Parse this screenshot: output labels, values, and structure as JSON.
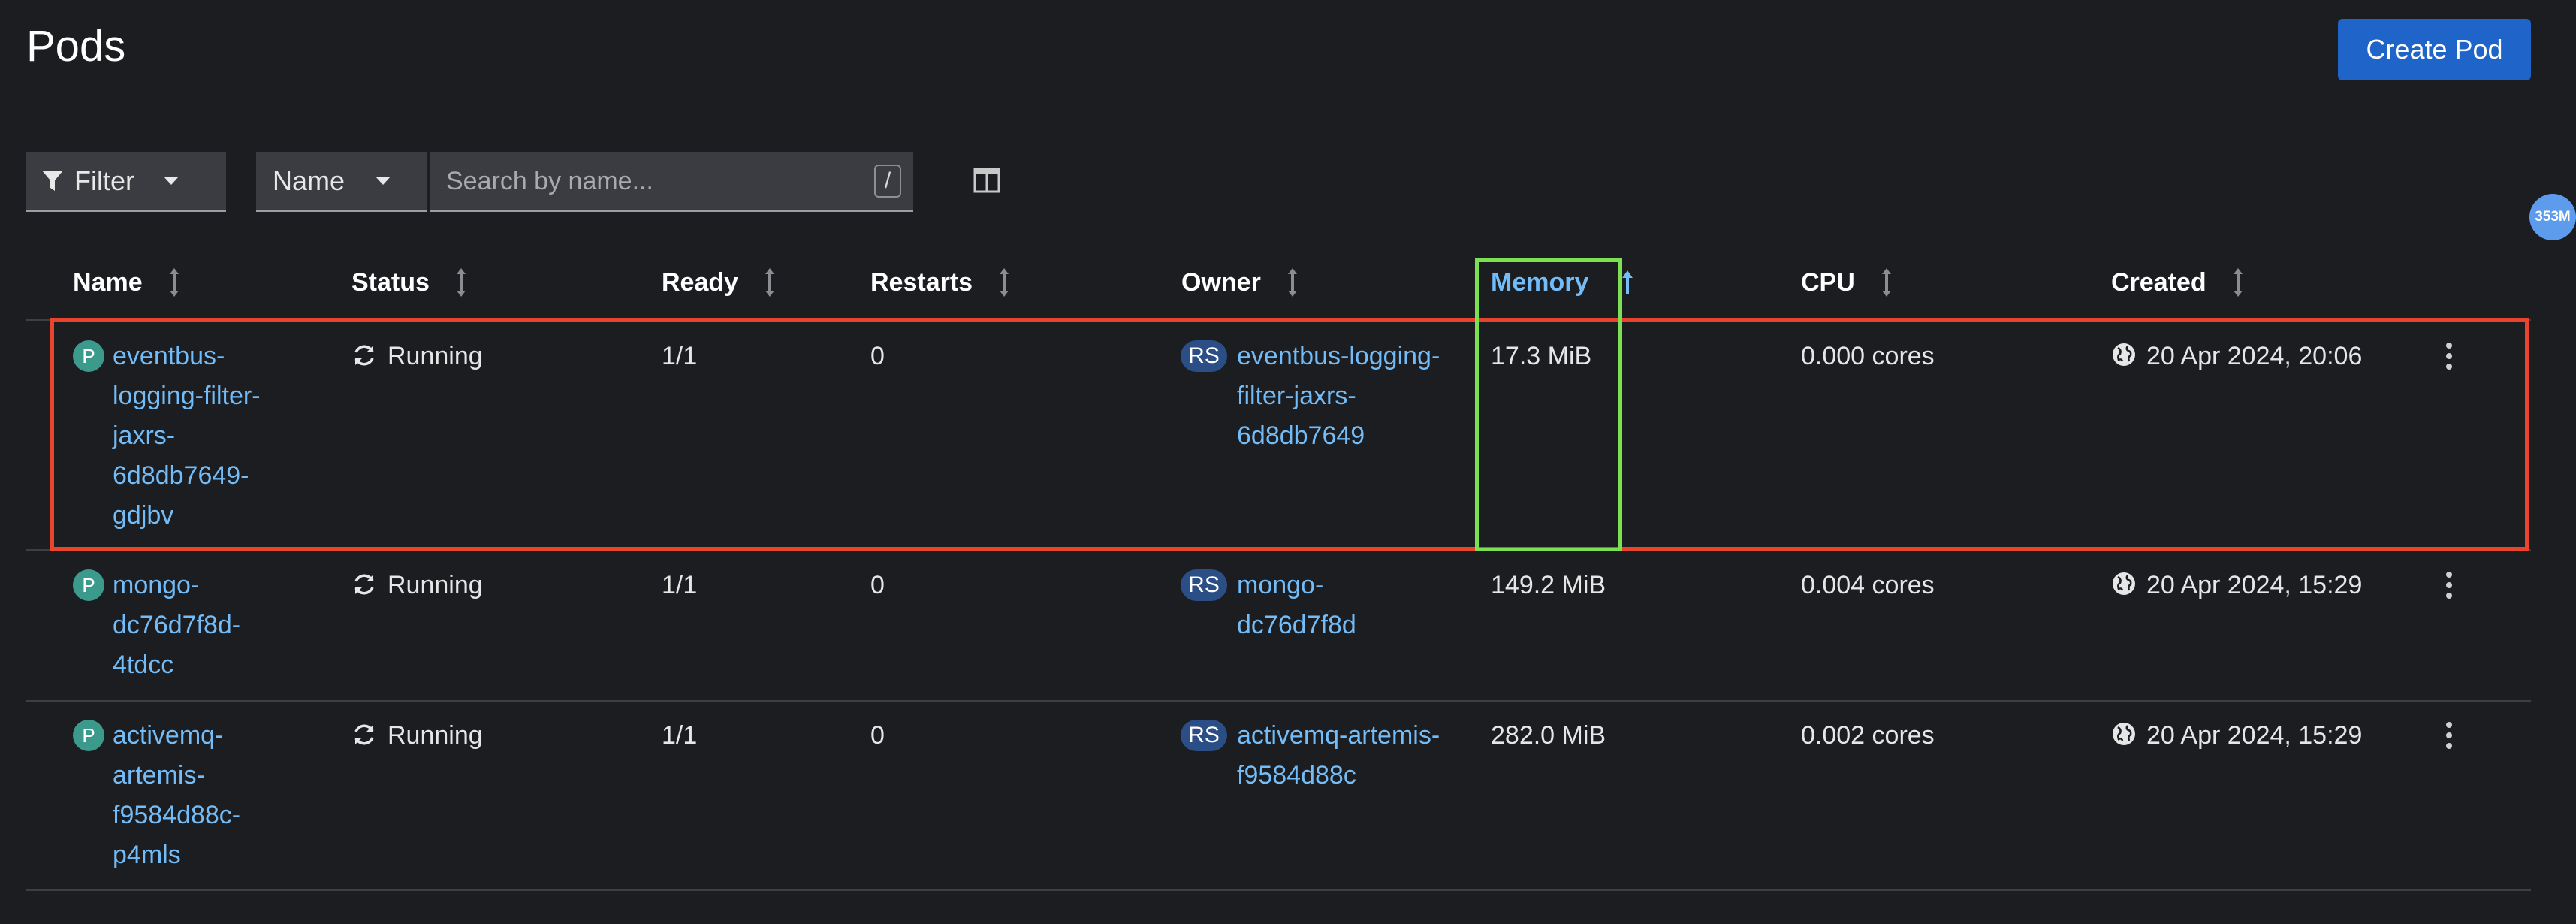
{
  "page": {
    "title": "Pods",
    "create_button": "Create Pod"
  },
  "toolbar": {
    "filter_label": "Filter",
    "name_select": "Name",
    "search_placeholder": "Search by name...",
    "search_shortcut": "/"
  },
  "floating_badge": "353M",
  "columns": {
    "name": "Name",
    "status": "Status",
    "ready": "Ready",
    "restarts": "Restarts",
    "owner": "Owner",
    "memory": "Memory",
    "cpu": "CPU",
    "created": "Created"
  },
  "rows": [
    {
      "badge": "P",
      "name_lines": [
        "eventbus-",
        "logging-filter-",
        "jaxrs-",
        "6d8db7649-",
        "gdjbv"
      ],
      "status": "Running",
      "ready": "1/1",
      "restarts": "0",
      "owner_badge": "RS",
      "owner_lines": [
        "eventbus-logging-",
        "filter-jaxrs-",
        "6d8db7649"
      ],
      "memory": "17.3 MiB",
      "cpu": "0.000 cores",
      "created": "20 Apr 2024, 20:06"
    },
    {
      "badge": "P",
      "name_lines": [
        "mongo-",
        "dc76d7f8d-",
        "4tdcc"
      ],
      "status": "Running",
      "ready": "1/1",
      "restarts": "0",
      "owner_badge": "RS",
      "owner_lines": [
        "mongo-",
        "dc76d7f8d"
      ],
      "memory": "149.2 MiB",
      "cpu": "0.004 cores",
      "created": "20 Apr 2024, 15:29"
    },
    {
      "badge": "P",
      "name_lines": [
        "activemq-",
        "artemis-",
        "f9584d88c-",
        "p4mls"
      ],
      "status": "Running",
      "ready": "1/1",
      "restarts": "0",
      "owner_badge": "RS",
      "owner_lines": [
        "activemq-artemis-",
        "f9584d88c"
      ],
      "memory": "282.0 MiB",
      "cpu": "0.002 cores",
      "created": "20 Apr 2024, 15:29"
    }
  ],
  "colors": {
    "background": "#1b1d21",
    "link": "#73bcf7",
    "primary_button": "#1f64c8",
    "highlight_row": "#e8452c",
    "highlight_column": "#7de052"
  }
}
